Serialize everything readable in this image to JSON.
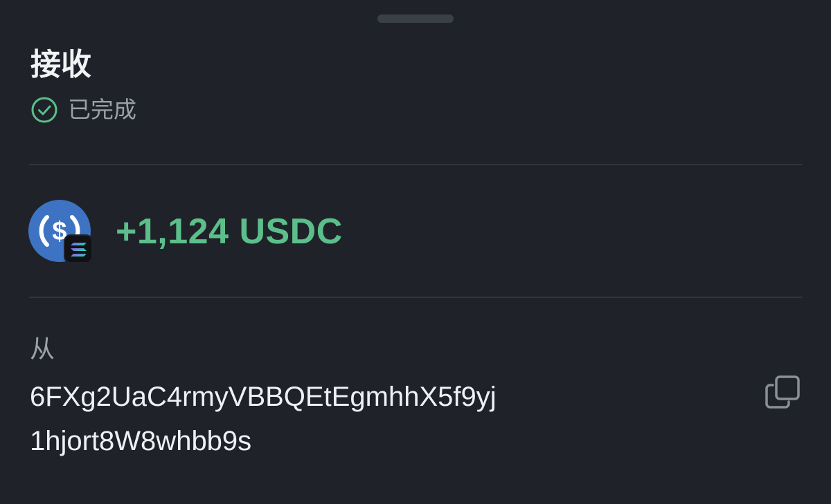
{
  "sheet": {
    "title": "接收",
    "status": {
      "text": "已完成",
      "icon": "check-circle-icon",
      "color": "#5cbf8b"
    }
  },
  "transfer": {
    "amount": "+1,124 USDC",
    "token_icon": "usdc-icon",
    "chain_badge_icon": "solana-icon",
    "amount_color": "#5cbf8b"
  },
  "sender": {
    "label": "从",
    "address_line1": "6FXg2UaC4rmyVBBQEtEgmhhX5f9yj",
    "address_line2": "1hjort8W8whbb9s",
    "copy_icon": "copy-icon"
  },
  "colors": {
    "background": "#1f2329",
    "usdc_blue": "#3e73c4",
    "text_primary": "#eef0f3",
    "text_secondary": "#9ba1a9"
  }
}
